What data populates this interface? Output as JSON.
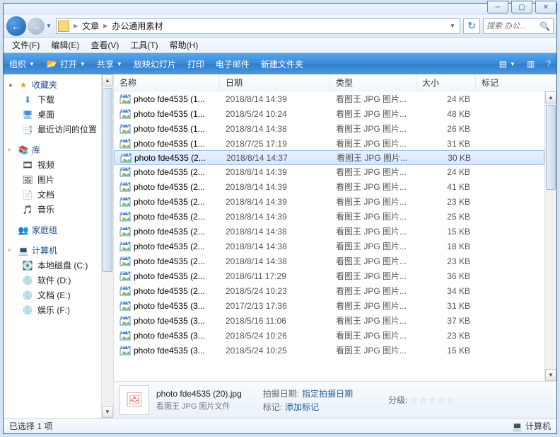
{
  "breadcrumb": {
    "seg1": "文章",
    "seg2": "办公通用素材"
  },
  "search": {
    "placeholder": "搜索 办公..."
  },
  "menu": {
    "file": "文件(F)",
    "edit": "编辑(E)",
    "view": "查看(V)",
    "tools": "工具(T)",
    "help": "帮助(H)"
  },
  "toolbar": {
    "org": "组织",
    "open": "打开",
    "share": "共享",
    "slide": "放映幻灯片",
    "print": "打印",
    "email": "电子邮件",
    "new": "新建文件夹"
  },
  "sidebar": {
    "fav": "收藏夹",
    "downloads": "下载",
    "desktop": "桌面",
    "recent": "最近访问的位置",
    "lib": "库",
    "video": "视频",
    "pictures": "图片",
    "docs": "文档",
    "music": "音乐",
    "homegroup": "家庭组",
    "computer": "计算机",
    "disk_c": "本地磁盘 (C:)",
    "disk_d": "软件 (D:)",
    "disk_e": "文档 (E:)",
    "disk_f": "娱乐 (F:)"
  },
  "columns": {
    "name": "名称",
    "date": "日期",
    "type": "类型",
    "size": "大小",
    "tag": "标记"
  },
  "files": [
    {
      "name": "photo fde4535 (3...",
      "date": "2018/5/24 10:25",
      "type": "看图王 JPG 图片...",
      "size": "15 KB",
      "sel": false
    },
    {
      "name": "photo fde4535 (3...",
      "date": "2018/5/24 10:26",
      "type": "看图王 JPG 图片...",
      "size": "23 KB",
      "sel": false
    },
    {
      "name": "photo fde4535 (3...",
      "date": "2018/5/16 11:06",
      "type": "看图王 JPG 图片...",
      "size": "37 KB",
      "sel": false
    },
    {
      "name": "photo fde4535 (3...",
      "date": "2017/2/13 17:36",
      "type": "看图王 JPG 图片...",
      "size": "31 KB",
      "sel": false
    },
    {
      "name": "photo fde4535 (2...",
      "date": "2018/5/24 10:23",
      "type": "看图王 JPG 图片...",
      "size": "34 KB",
      "sel": false
    },
    {
      "name": "photo fde4535 (2...",
      "date": "2018/6/11 17:29",
      "type": "看图王 JPG 图片...",
      "size": "36 KB",
      "sel": false
    },
    {
      "name": "photo fde4535 (2...",
      "date": "2018/8/14 14:38",
      "type": "看图王 JPG 图片...",
      "size": "23 KB",
      "sel": false
    },
    {
      "name": "photo fde4535 (2...",
      "date": "2018/8/14 14:38",
      "type": "看图王 JPG 图片...",
      "size": "18 KB",
      "sel": false
    },
    {
      "name": "photo fde4535 (2...",
      "date": "2018/8/14 14:38",
      "type": "看图王 JPG 图片...",
      "size": "15 KB",
      "sel": false
    },
    {
      "name": "photo fde4535 (2...",
      "date": "2018/8/14 14:39",
      "type": "看图王 JPG 图片...",
      "size": "25 KB",
      "sel": false
    },
    {
      "name": "photo fde4535 (2...",
      "date": "2018/8/14 14:39",
      "type": "看图王 JPG 图片...",
      "size": "23 KB",
      "sel": false
    },
    {
      "name": "photo fde4535 (2...",
      "date": "2018/8/14 14:39",
      "type": "看图王 JPG 图片...",
      "size": "41 KB",
      "sel": false
    },
    {
      "name": "photo fde4535 (2...",
      "date": "2018/8/14 14:39",
      "type": "看图王 JPG 图片...",
      "size": "24 KB",
      "sel": false
    },
    {
      "name": "photo fde4535 (2...",
      "date": "2018/8/14 14:37",
      "type": "看图王 JPG 图片...",
      "size": "30 KB",
      "sel": true
    },
    {
      "name": "photo fde4535 (1...",
      "date": "2018/7/25 17:19",
      "type": "看图王 JPG 图片...",
      "size": "31 KB",
      "sel": false
    },
    {
      "name": "photo fde4535 (1...",
      "date": "2018/8/14 14:38",
      "type": "看图王 JPG 图片...",
      "size": "26 KB",
      "sel": false
    },
    {
      "name": "photo fde4535 (1...",
      "date": "2018/5/24 10:24",
      "type": "看图王 JPG 图片...",
      "size": "48 KB",
      "sel": false
    },
    {
      "name": "photo fde4535 (1...",
      "date": "2018/8/14 14:39",
      "type": "看图王 JPG 图片...",
      "size": "24 KB",
      "sel": false
    }
  ],
  "details": {
    "title": "photo fde4535 (20).jpg",
    "sub": "看图王 JPG 图片文件",
    "shot_label": "拍摄日期:",
    "shot_val": "指定拍摄日期",
    "tag_label": "标记:",
    "tag_val": "添加标记",
    "rating_label": "分级:"
  },
  "status": {
    "sel": "已选择 1 项",
    "comp": "计算机"
  }
}
